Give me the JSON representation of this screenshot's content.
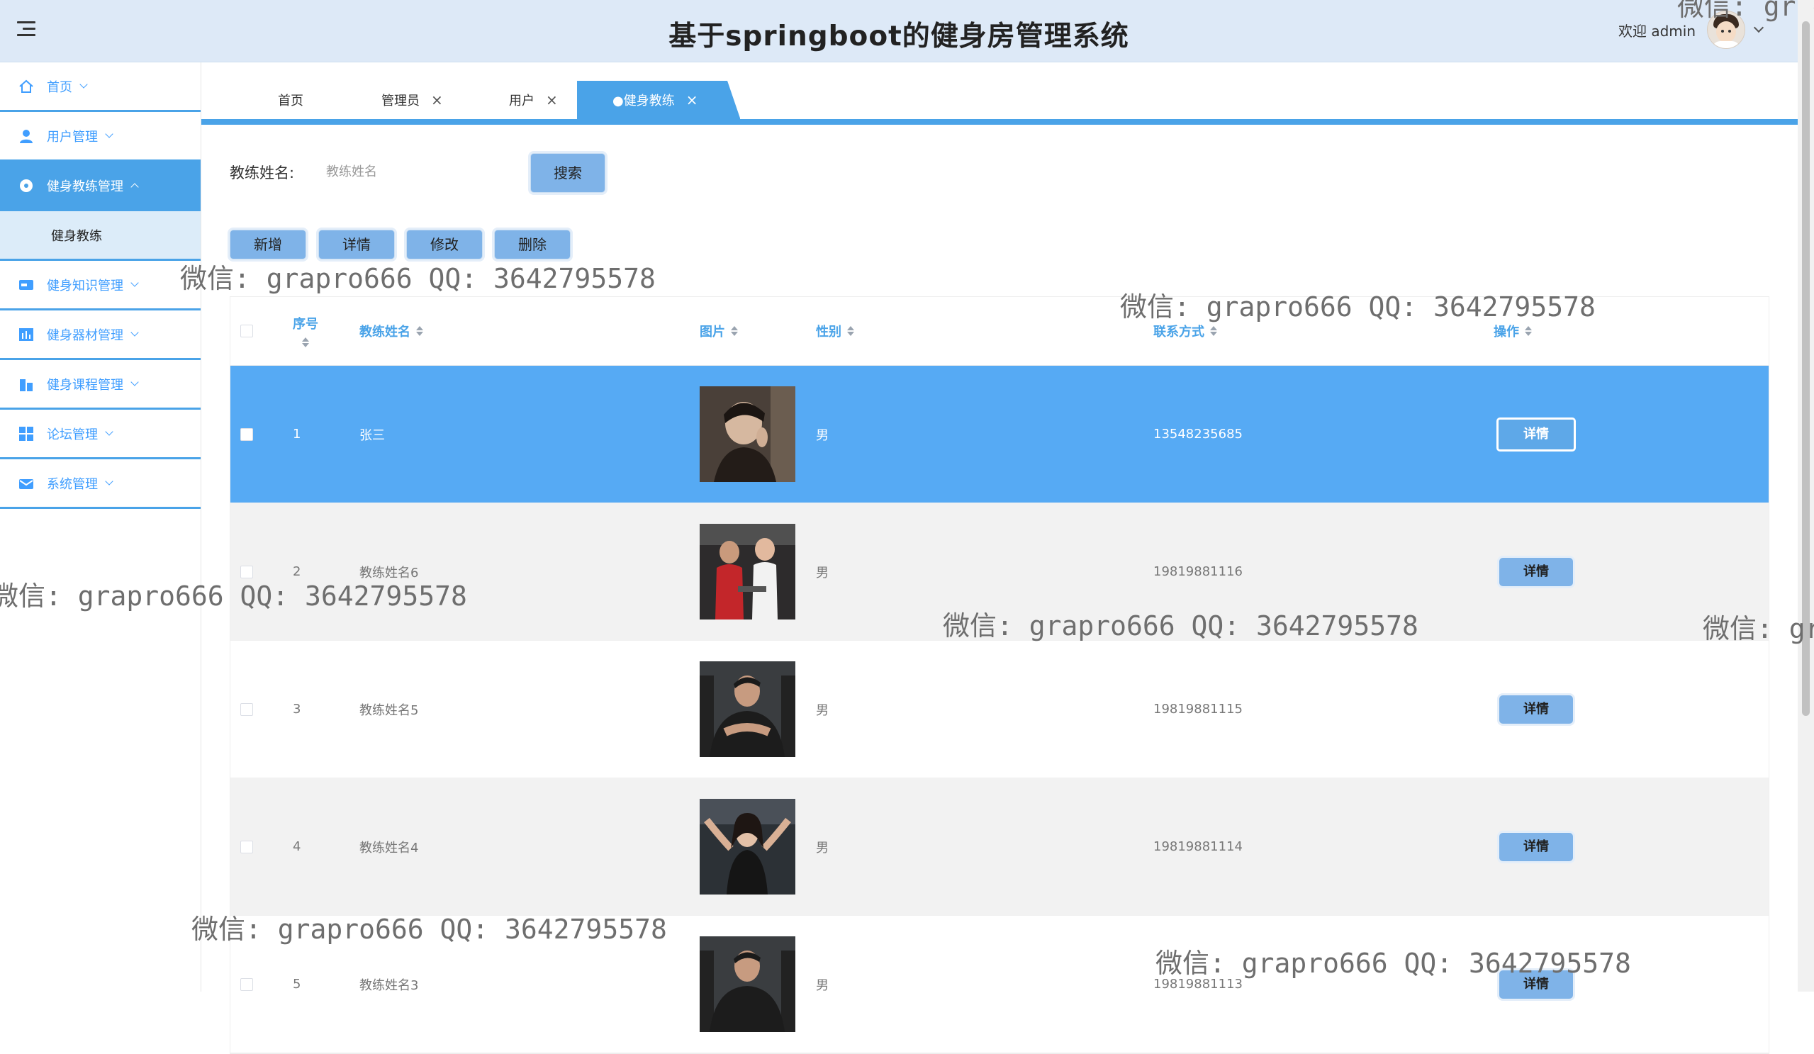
{
  "header": {
    "title": "基于springboot的健身房管理系统",
    "welcome": "欢迎 admin"
  },
  "sidebar": {
    "items": [
      {
        "label": "首页",
        "icon": "home-icon"
      },
      {
        "label": "用户管理",
        "icon": "user-icon"
      },
      {
        "label": "健身教练管理",
        "icon": "circle-icon",
        "active": true
      },
      {
        "label": "健身知识管理",
        "icon": "card-icon"
      },
      {
        "label": "健身器材管理",
        "icon": "chart-icon"
      },
      {
        "label": "健身课程管理",
        "icon": "building-icon"
      },
      {
        "label": "论坛管理",
        "icon": "grid-icon"
      },
      {
        "label": "系统管理",
        "icon": "mail-icon"
      }
    ],
    "submenu": [
      "健身教练"
    ]
  },
  "tabs": [
    {
      "label": "首页",
      "closable": false
    },
    {
      "label": "管理员",
      "closable": true
    },
    {
      "label": "用户",
      "closable": true
    },
    {
      "label": "●健身教练",
      "closable": true,
      "active": true
    }
  ],
  "search": {
    "label": "教练姓名:",
    "placeholder": "教练姓名",
    "button": "搜索"
  },
  "actions": {
    "add": "新增",
    "detail": "详情",
    "edit": "修改",
    "delete": "删除"
  },
  "table": {
    "columns": [
      "序号",
      "教练姓名",
      "图片",
      "性别",
      "联系方式",
      "操作"
    ],
    "rows": [
      {
        "index": "1",
        "name": "张三",
        "gender": "男",
        "phone": "13548235685",
        "action": "详情",
        "selected": true
      },
      {
        "index": "2",
        "name": "教练姓名6",
        "gender": "男",
        "phone": "19819881116",
        "action": "详情"
      },
      {
        "index": "3",
        "name": "教练姓名5",
        "gender": "男",
        "phone": "19819881115",
        "action": "详情"
      },
      {
        "index": "4",
        "name": "教练姓名4",
        "gender": "男",
        "phone": "19819881114",
        "action": "详情"
      },
      {
        "index": "5",
        "name": "教练姓名3",
        "gender": "男",
        "phone": "19819881113",
        "action": "详情"
      }
    ]
  },
  "watermark": {
    "text": "微信: grapro666 QQ: 3642795578",
    "partial_right": "微信: gr",
    "partial_top": "微信: gr q"
  },
  "colors": {
    "accent": "#4aa3e8",
    "selected_row": "#56aaf4",
    "header_bg": "#dde9f7",
    "button": "#7fb3e8"
  }
}
